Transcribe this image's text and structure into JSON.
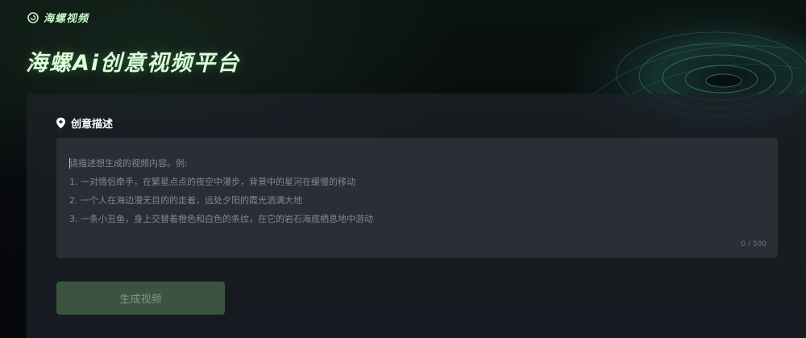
{
  "brand": {
    "logo_icon": "snail-logo-icon",
    "name": "海螺视频"
  },
  "hero": {
    "title": "海螺Ai创意视频平台"
  },
  "creative": {
    "section_icon": "location-pin-icon",
    "section_label": "创意描述",
    "prompt": {
      "value": "",
      "placeholder": "请描述想生成的视频内容。例:\n1. 一对情侣牵手，在繁星点点的夜空中漫步，背景中的星河在缓慢的移动\n2. 一个人在海边漫无目的的走着，远处夕阳的霞光洒满大地\n3. 一条小丑鱼，身上交替着橙色和白色的条纹，在它的岩石海底栖息地中游动",
      "max_length": 500
    },
    "counter": "0 / 500"
  },
  "actions": {
    "generate_label": "生成视频"
  },
  "colors": {
    "accent_text": "#d8ffd6",
    "button_bg": "#3a5440",
    "button_text": "#7f9a84",
    "panel_bg": "#1c2128",
    "input_bg": "#2a2f36"
  }
}
